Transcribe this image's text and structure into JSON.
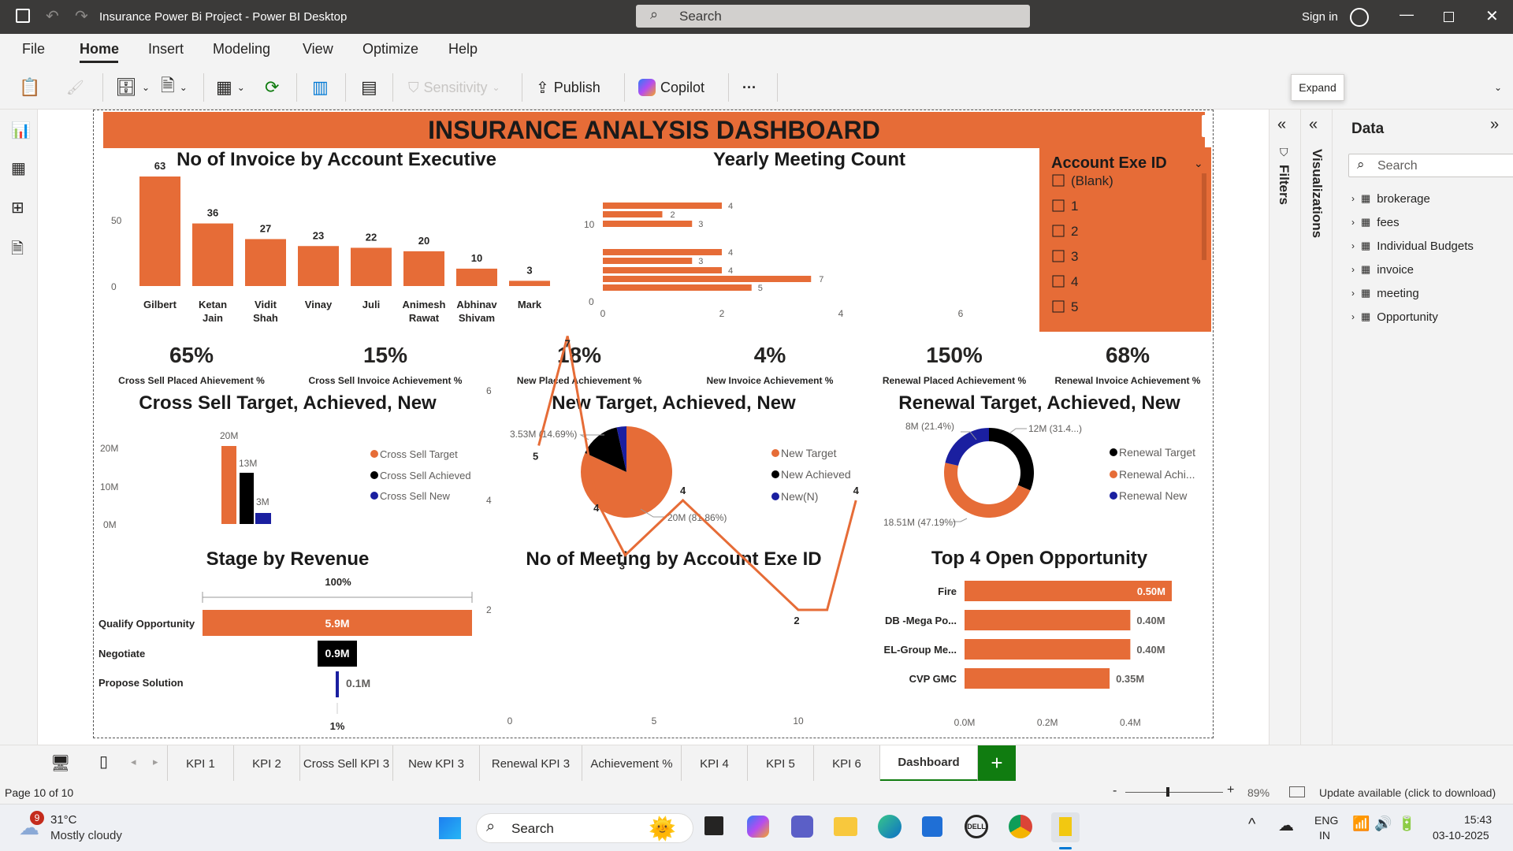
{
  "titlebar": {
    "title": "Insurance Power Bi Project - Power BI Desktop",
    "search_placeholder": "Search",
    "signin": "Sign in"
  },
  "menu": [
    "File",
    "Home",
    "Insert",
    "Modeling",
    "View",
    "Optimize",
    "Help"
  ],
  "ribbon": {
    "sensitivity": "Sensitivity",
    "publish": "Publish",
    "copilot": "Copilot",
    "more": "···"
  },
  "tooltip": "Expand",
  "dashboard": {
    "title": "INSURANCE ANALYSIS DASHBOARD",
    "invoice_chart": {
      "title": "No of Invoice by Account Executive",
      "categories": [
        "Gilbert",
        "Ketan Jain",
        "Vidit Shah",
        "Vinay",
        "Juli",
        "Animesh Rawat",
        "Abhinav Shivam",
        "Mark"
      ],
      "values": [
        63,
        36,
        27,
        23,
        22,
        20,
        10,
        3
      ],
      "yticks": [
        "50",
        "0"
      ]
    },
    "yearly_meeting": {
      "title": "Yearly Meeting Count",
      "yticks": [
        "10",
        "0"
      ],
      "xticks": [
        "0",
        "2",
        "4",
        "6"
      ],
      "labels": [
        "4",
        "2",
        "3",
        "4",
        "3",
        "4",
        "7",
        "5"
      ]
    },
    "slicer": {
      "title": "Account Exe ID",
      "items": [
        "(Blank)",
        "1",
        "2",
        "3",
        "4",
        "5"
      ]
    },
    "kpis": [
      {
        "value": "65%",
        "label": "Cross Sell Placed Ahievement %"
      },
      {
        "value": "15%",
        "label": "Cross Sell Invoice Achievement %"
      },
      {
        "value": "18%",
        "label": "New Placed Achievement %"
      },
      {
        "value": "4%",
        "label": "New Invoice Achievement %"
      },
      {
        "value": "150%",
        "label": "Renewal Placed Achievement %"
      },
      {
        "value": "68%",
        "label": "Renewal Invoice Achievement %"
      }
    ],
    "cross_sell": {
      "title": "Cross Sell Target, Achieved, New",
      "yticks": [
        "20M",
        "10M",
        "0M"
      ],
      "bar_labels": [
        "20M",
        "13M",
        "3M"
      ],
      "legend": [
        "Cross Sell Target",
        "Cross Sell Achieved",
        "Cross Sell New"
      ]
    },
    "new_pie": {
      "title": "New Target, Achieved, New",
      "labels": [
        "3.53M (14.69%)",
        "20M (81.86%)"
      ],
      "legend": [
        "New Target",
        "New Achieved",
        "New(N)"
      ]
    },
    "renewal_donut": {
      "title": "Renewal Target, Achieved, New",
      "labels": [
        "8M (21.4%)",
        "12M (31.4...)",
        "18.51M (47.19%)"
      ],
      "legend": [
        "Renewal Target",
        "Renewal Achi...",
        "Renewal New"
      ]
    },
    "stage": {
      "title": "Stage by Revenue",
      "top": "100%",
      "bottom": "1%",
      "stages": [
        "Qualify Opportunity",
        "Negotiate",
        "Propose Solution"
      ],
      "values": [
        "5.9M",
        "0.9M",
        "0.1M"
      ]
    },
    "meeting_line": {
      "title": "No of Meeting by Account Exe ID",
      "yticks": [
        "6",
        "4",
        "2"
      ],
      "xticks": [
        "0",
        "5",
        "10"
      ],
      "labels": [
        "5",
        "7",
        "4",
        "3",
        "4",
        "2",
        "4"
      ]
    },
    "top4": {
      "title": "Top 4 Open Opportunity",
      "categories": [
        "Fire",
        "DB -Mega Po...",
        "EL-Group Me...",
        "CVP GMC"
      ],
      "values": [
        "0.50M",
        "0.40M",
        "0.40M",
        "0.35M"
      ],
      "xticks": [
        "0.0M",
        "0.2M",
        "0.4M"
      ]
    }
  },
  "chart_data": [
    {
      "type": "bar",
      "title": "No of Invoice by Account Executive",
      "categories": [
        "Gilbert",
        "Ketan Jain",
        "Vidit Shah",
        "Vinay",
        "Juli",
        "Animesh Rawat",
        "Abhinav Shivam",
        "Mark"
      ],
      "values": [
        63,
        36,
        27,
        23,
        22,
        20,
        10,
        3
      ]
    },
    {
      "type": "bar",
      "title": "Cross Sell Target, Achieved, New",
      "categories": [
        "Cross Sell Target",
        "Cross Sell Achieved",
        "Cross Sell New"
      ],
      "values": [
        20,
        13,
        3
      ],
      "ylabel": "",
      "ylim": [
        0,
        20
      ]
    },
    {
      "type": "pie",
      "title": "New Target, Achieved, New",
      "categories": [
        "New Target",
        "New Achieved",
        "New(N)"
      ],
      "values": [
        81.86,
        14.69,
        3.45
      ]
    },
    {
      "type": "pie",
      "title": "Renewal Target, Achieved, New",
      "categories": [
        "Renewal Target",
        "Renewal Achi...",
        "Renewal New"
      ],
      "values": [
        31.4,
        47.19,
        21.4
      ]
    },
    {
      "type": "line",
      "title": "No of Meeting by Account Exe ID",
      "x": [
        1,
        2,
        3,
        4,
        6,
        10,
        11,
        12
      ],
      "y": [
        5,
        7,
        4,
        3,
        4,
        2,
        2,
        4
      ]
    },
    {
      "type": "bar",
      "title": "Top 4 Open Opportunity",
      "categories": [
        "Fire",
        "DB -Mega Po...",
        "EL-Group Me...",
        "CVP GMC"
      ],
      "values": [
        0.5,
        0.4,
        0.4,
        0.35
      ]
    }
  ],
  "panes": {
    "filters": "Filters",
    "visualizations": "Visualizations",
    "data_title": "Data",
    "search_placeholder": "Search",
    "tables": [
      "brokerage",
      "fees",
      "Individual Budgets",
      "invoice",
      "meeting",
      "Opportunity"
    ]
  },
  "tabs": [
    "KPI 1",
    "KPI 2",
    "Cross Sell KPI 3",
    "New KPI 3",
    "Renewal KPI 3",
    "Achievement %",
    "KPI 4",
    "KPI 5",
    "KPI 6",
    "Dashboard"
  ],
  "status": {
    "page": "Page 10 of 10",
    "zoom": "89%",
    "update": "Update available (click to download)"
  },
  "taskbar": {
    "temp": "31°C",
    "weather": "Mostly cloudy",
    "badge": "9",
    "search": "Search",
    "lang1": "ENG",
    "lang2": "IN",
    "time": "15:43",
    "date": "03-10-2025"
  },
  "colors": {
    "orange": "#e66c37",
    "black": "#000000",
    "navy": "#1a1fa0",
    "titlebar": "#3b3a39"
  }
}
